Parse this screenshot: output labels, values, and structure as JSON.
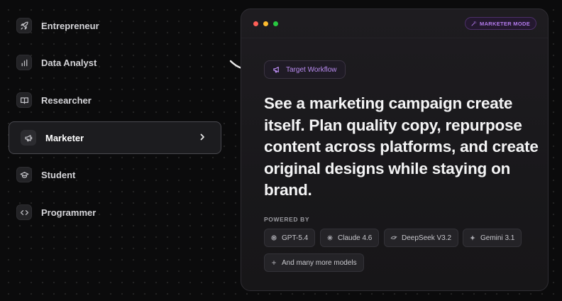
{
  "sidebar": {
    "items": [
      {
        "label": "Entrepreneur",
        "icon": "rocket-icon"
      },
      {
        "label": "Data Analyst",
        "icon": "bar-chart-icon"
      },
      {
        "label": "Researcher",
        "icon": "book-icon"
      },
      {
        "label": "Marketer",
        "icon": "megaphone-icon",
        "active": true
      },
      {
        "label": "Student",
        "icon": "graduation-cap-icon"
      },
      {
        "label": "Programmer",
        "icon": "code-icon"
      }
    ]
  },
  "panel": {
    "mode_badge": "MARKETER MODE",
    "workflow_pill": "Target Workflow",
    "headline": "See a marketing campaign create itself. Plan quality copy, repurpose content across platforms, and create original designs while staying on brand.",
    "powered_by": "POWERED BY",
    "models": [
      {
        "label": "GPT-5.4",
        "icon": "openai-icon"
      },
      {
        "label": "Claude 4.6",
        "icon": "claude-icon"
      },
      {
        "label": "DeepSeek V3.2",
        "icon": "deepseek-icon"
      },
      {
        "label": "Gemini 3.1",
        "icon": "gemini-icon"
      }
    ],
    "more_models": "And many more models"
  },
  "colors": {
    "accent": "#b57bef",
    "window_dot_red": "#ff5f57",
    "window_dot_yellow": "#febc2e",
    "window_dot_green": "#28c840"
  }
}
